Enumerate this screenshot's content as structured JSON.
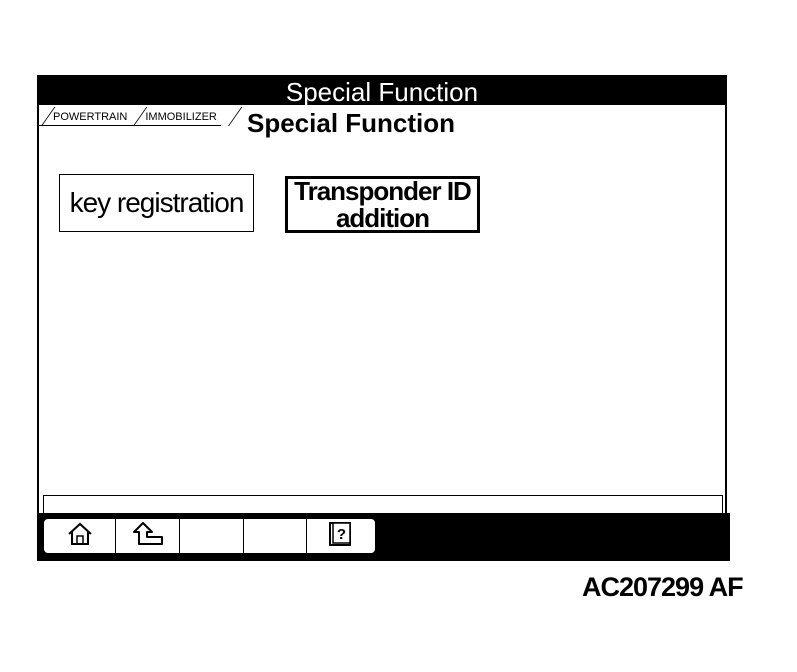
{
  "window": {
    "title": "Special Function"
  },
  "breadcrumb": {
    "items": [
      "POWERTRAIN",
      "IMMOBILIZER"
    ]
  },
  "page_heading": "Special Function",
  "functions": {
    "key_registration": "key registration",
    "transponder_id_addition_line1": "Transponder ID",
    "transponder_id_addition_line2": "addition"
  },
  "toolbar": {
    "buttons": [
      {
        "icon": "home-icon"
      },
      {
        "icon": "back-arrow-icon"
      },
      {
        "icon": "blank"
      },
      {
        "icon": "blank"
      },
      {
        "icon": "help-book-icon"
      }
    ]
  },
  "document_code": "AC207299 AF"
}
